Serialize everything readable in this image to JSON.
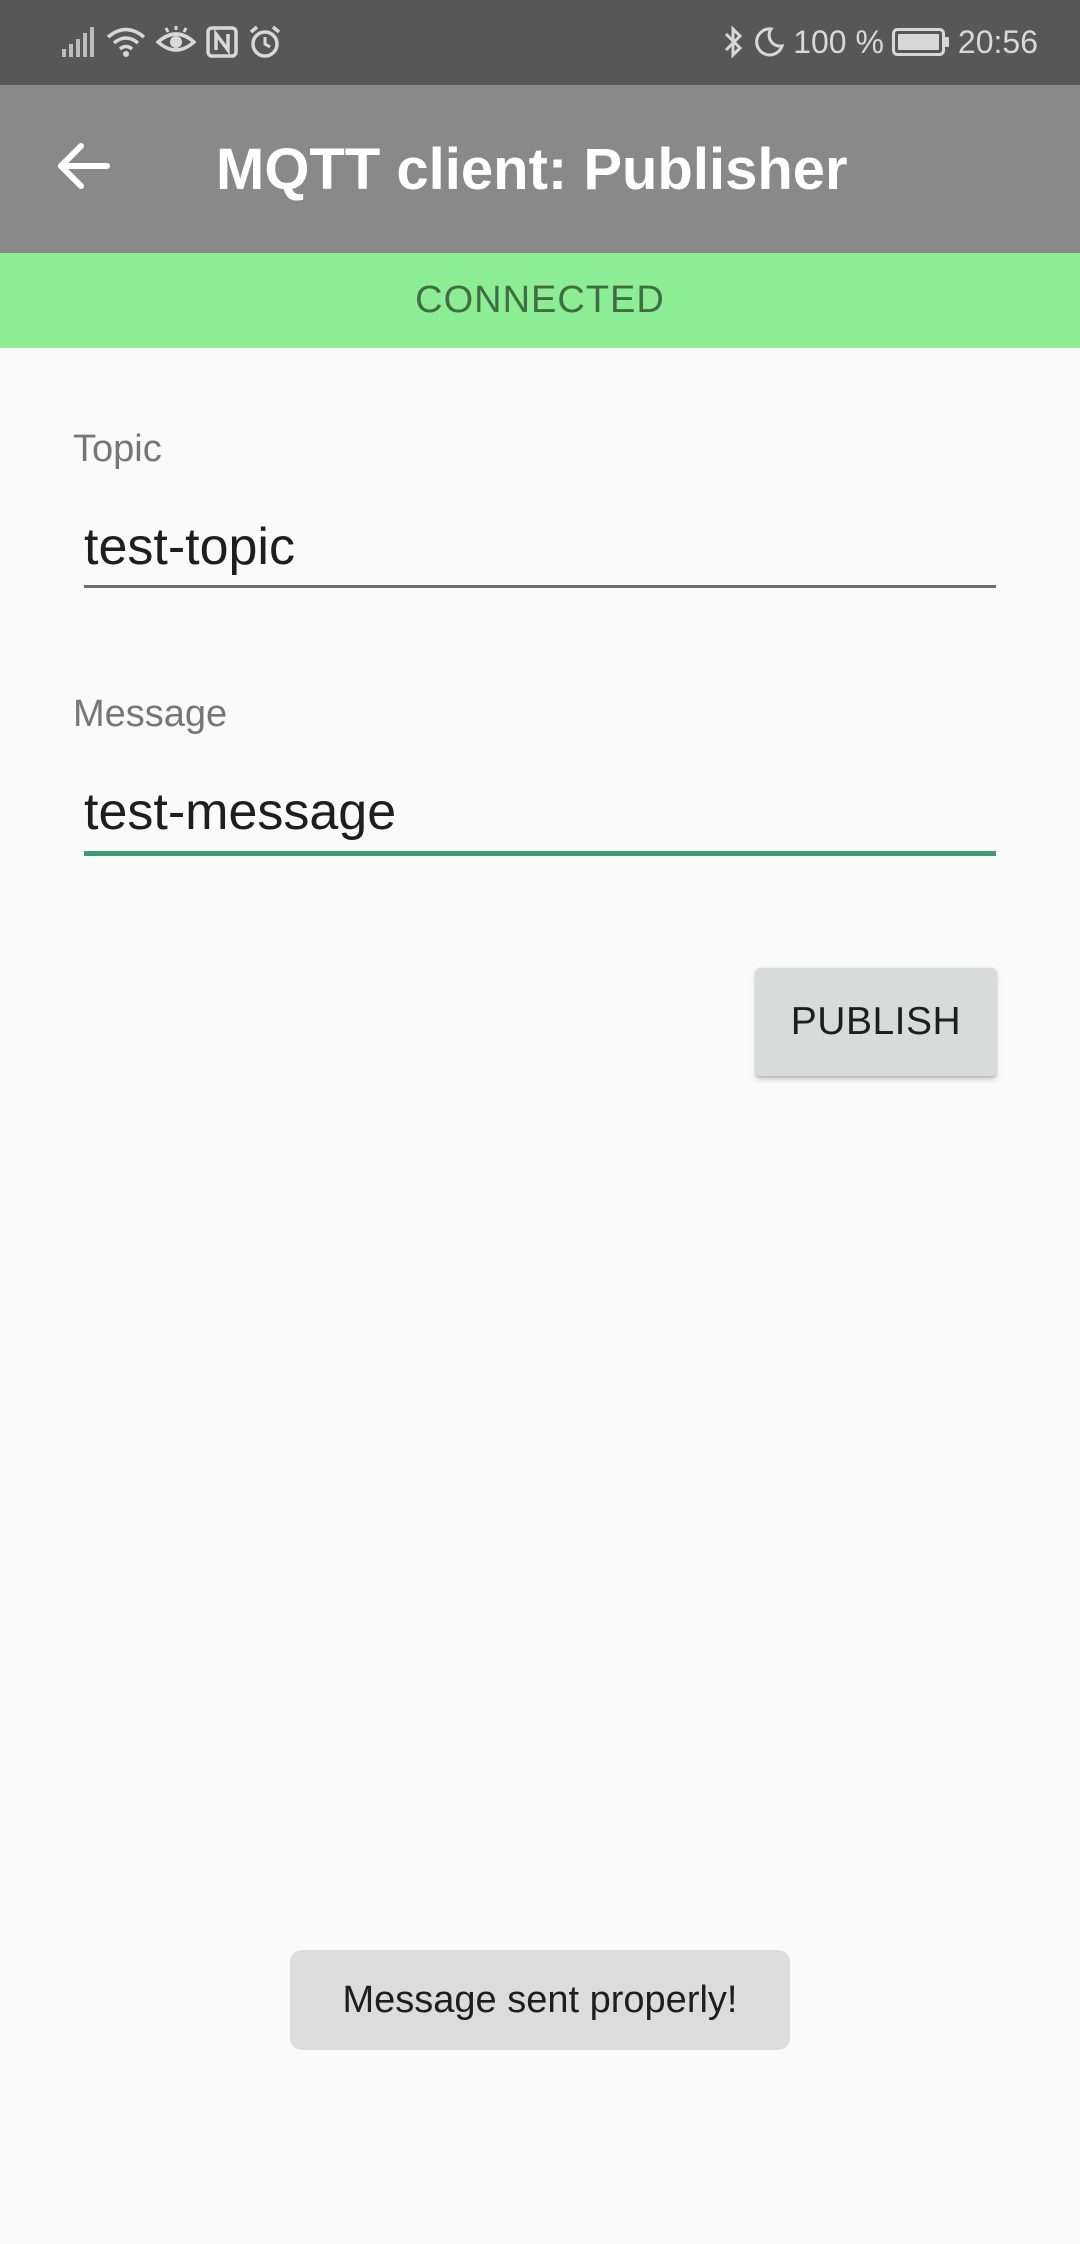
{
  "status_bar": {
    "battery_percent": "100 %",
    "time": "20:56",
    "left_icons": [
      "signal-icon",
      "wifi-icon",
      "eye-icon",
      "nfc-icon",
      "alarm-icon"
    ],
    "right_icons": [
      "bluetooth-icon",
      "moon-icon",
      "battery-icon"
    ]
  },
  "app_bar": {
    "title": "MQTT client: Publisher",
    "back_icon": "arrow-back-icon",
    "background": "#898989"
  },
  "connection": {
    "status": "CONNECTED",
    "color": "#8ded94"
  },
  "form": {
    "topic": {
      "label": "Topic",
      "value": "test-topic"
    },
    "message": {
      "label": "Message",
      "value": "test-message",
      "focused_color": "#3d9b73"
    },
    "publish_label": "PUBLISH"
  },
  "toast": {
    "text": "Message sent properly!"
  }
}
